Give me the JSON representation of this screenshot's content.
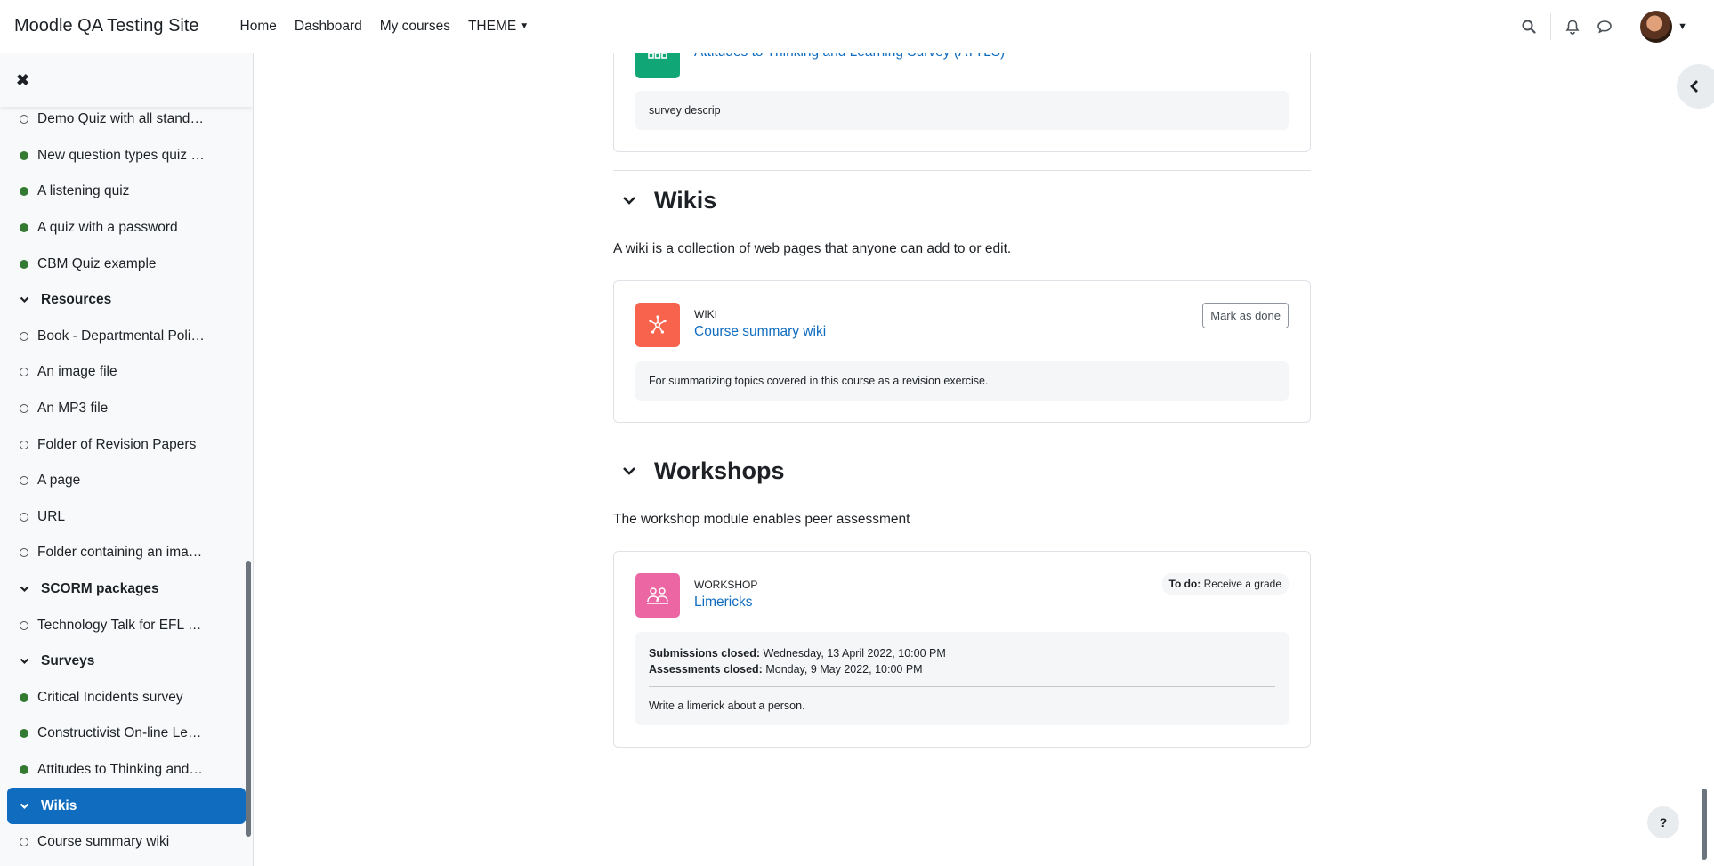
{
  "navbar": {
    "brand": "Moodle QA Testing Site",
    "links": [
      "Home",
      "Dashboard",
      "My courses",
      "THEME"
    ]
  },
  "drawer": {
    "items": [
      {
        "kind": "item",
        "label": "Demo Quiz with all standa…",
        "done": false
      },
      {
        "kind": "item",
        "label": "New question types quiz - …",
        "done": true
      },
      {
        "kind": "item",
        "label": "A listening quiz",
        "done": true
      },
      {
        "kind": "item",
        "label": "A quiz with a password",
        "done": true
      },
      {
        "kind": "item",
        "label": "CBM Quiz example",
        "done": true
      },
      {
        "kind": "section",
        "label": "Resources"
      },
      {
        "kind": "item",
        "label": "Book - Departmental Polic…",
        "done": false
      },
      {
        "kind": "item",
        "label": "An image file",
        "done": false
      },
      {
        "kind": "item",
        "label": "An MP3 file",
        "done": false
      },
      {
        "kind": "item",
        "label": "Folder of Revision Papers",
        "done": false
      },
      {
        "kind": "item",
        "label": "A page",
        "done": false
      },
      {
        "kind": "item",
        "label": "URL",
        "done": false
      },
      {
        "kind": "item",
        "label": "Folder containing an imag…",
        "done": false
      },
      {
        "kind": "section",
        "label": "SCORM packages"
      },
      {
        "kind": "item",
        "label": "Technology Talk for EFL C…",
        "done": false
      },
      {
        "kind": "section",
        "label": "Surveys"
      },
      {
        "kind": "item",
        "label": "Critical Incidents survey",
        "done": true
      },
      {
        "kind": "item",
        "label": "Constructivist On-line Lea…",
        "done": true
      },
      {
        "kind": "item",
        "label": "Attitudes to Thinking and …",
        "done": true
      },
      {
        "kind": "section",
        "label": "Wikis",
        "active": true
      },
      {
        "kind": "item",
        "label": "Course summary wiki",
        "done": false
      }
    ]
  },
  "survey_card": {
    "name": "Attitudes to Thinking and Learning Survey (ATTLS)",
    "description": "survey descrip"
  },
  "wikis": {
    "title": "Wikis",
    "summary": "A wiki is a collection of web pages that anyone can add to or edit.",
    "activity": {
      "type": "WIKI",
      "name": "Course summary wiki",
      "button": "Mark as done",
      "description": "For summarizing topics covered in this course as a revision exercise."
    }
  },
  "workshops": {
    "title": "Workshops",
    "summary": "The workshop module enables peer assessment",
    "activity": {
      "type": "WORKSHOP",
      "name": "Limericks",
      "todo_label": "To do:",
      "todo_value": "Receive a grade",
      "submissions_label": "Submissions closed:",
      "submissions_value": "Wednesday, 13 April 2022, 10:00 PM",
      "assessments_label": "Assessments closed:",
      "assessments_value": "Monday, 9 May 2022, 10:00 PM",
      "description": "Write a limerick about a person."
    }
  },
  "help": {
    "label": "?"
  },
  "colors": {
    "primary": "#0f6cbf",
    "survey": "#11a676",
    "wiki": "#f7634d",
    "workshop": "#eb66a2",
    "done": "#357a32"
  }
}
